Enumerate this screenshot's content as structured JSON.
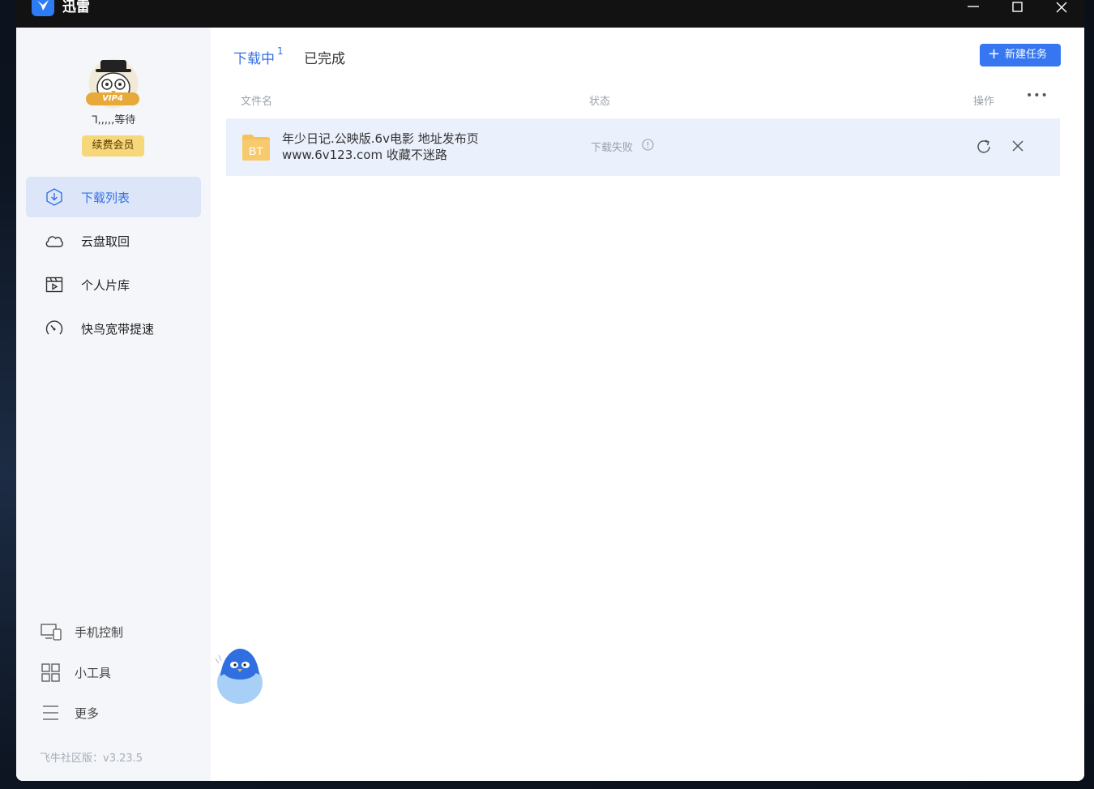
{
  "app": {
    "title": "迅雷"
  },
  "sidebar": {
    "vip_badge": "VIP4",
    "username": "ᒣ,,,,,等待",
    "renew_label": "续费会员",
    "nav": [
      {
        "label": "下载列表",
        "icon": "download-circle-icon",
        "active": true
      },
      {
        "label": "云盘取回",
        "icon": "cloud-icon",
        "active": false
      },
      {
        "label": "个人片库",
        "icon": "video-library-icon",
        "active": false
      },
      {
        "label": "快鸟宽带提速",
        "icon": "speedometer-icon",
        "active": false
      }
    ],
    "bottom": [
      {
        "label": "手机控制",
        "icon": "phone-control-icon"
      },
      {
        "label": "小工具",
        "icon": "grid-tools-icon"
      },
      {
        "label": "更多",
        "icon": "menu-icon"
      }
    ],
    "version": "飞牛社区版：v3.23.5"
  },
  "main": {
    "tabs": {
      "downloading": "下载中",
      "downloading_count": "1",
      "completed": "已完成"
    },
    "new_task_label": "新建任务",
    "columns": {
      "filename": "文件名",
      "status": "状态",
      "actions": "操作"
    },
    "tasks": [
      {
        "file_type": "BT",
        "name": "年少日记.公映版.6v电影 地址发布页 www.6v123.com 收藏不迷路",
        "status": "下载失败"
      }
    ]
  },
  "colors": {
    "accent": "#3677f1",
    "active_bg": "#dde6f9",
    "row_bg": "#ebf1fc",
    "bt_folder": "#f5c15b",
    "vip_gold": "#f6d77a"
  }
}
